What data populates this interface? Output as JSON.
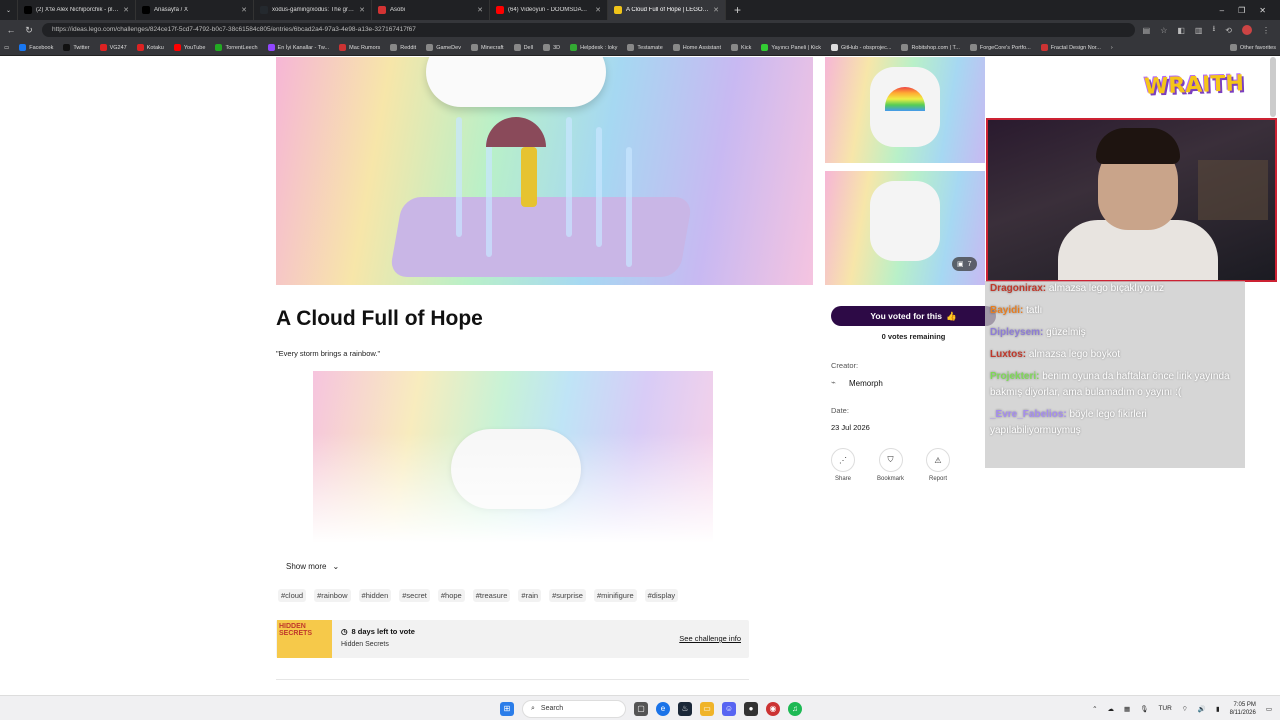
{
  "browser": {
    "tabs": [
      {
        "label": "(2) X'te Alex Nichiporchik - play S...",
        "icon": "x-icon",
        "color": "#000000"
      },
      {
        "label": "Anasayfa / X",
        "icon": "x-icon",
        "color": "#000000"
      },
      {
        "label": "xodus-gaming/xodus: The great g...",
        "icon": "github-icon",
        "color": "#24292e"
      },
      {
        "label": "Asobi",
        "icon": "asobi-icon",
        "color": "#d33333"
      },
      {
        "label": "(64) Videoyun - DOOMSDAY'den",
        "icon": "youtube-icon",
        "color": "#ff0000"
      },
      {
        "label": "A Cloud Full of Hope | LEGO® Ide...",
        "icon": "lego-icon",
        "color": "#f0c419",
        "active": true
      }
    ],
    "url": "https://ideas.lego.com/challenges/824ce17f-5cd7-4792-b0c7-38c61584c805/entries/6bcad2a4-97a3-4e98-a13e-327167417f67",
    "bookmarks": [
      {
        "label": "Facebook",
        "color": "#1877f2"
      },
      {
        "label": "Twitter",
        "color": "#111111"
      },
      {
        "label": "VG247",
        "color": "#d22"
      },
      {
        "label": "Kotaku",
        "color": "#d22"
      },
      {
        "label": "YouTube",
        "color": "#f00"
      },
      {
        "label": "TorrentLeech",
        "color": "#2a2"
      },
      {
        "label": "En İyi Kanallar - Tw...",
        "color": "#9146ff"
      },
      {
        "label": "Mac Rumors",
        "color": "#c33"
      },
      {
        "label": "Reddit",
        "color": "#888"
      },
      {
        "label": "GameDev",
        "color": "#888"
      },
      {
        "label": "Minecraft",
        "color": "#888"
      },
      {
        "label": "Dell",
        "color": "#888"
      },
      {
        "label": "3D",
        "color": "#888"
      },
      {
        "label": "Helpdesk : loky",
        "color": "#3a3"
      },
      {
        "label": "Testamate",
        "color": "#888"
      },
      {
        "label": "Home Assistant",
        "color": "#888"
      },
      {
        "label": "Kick",
        "color": "#888"
      },
      {
        "label": "Yayıncı Paneli | Kick",
        "color": "#3c3"
      },
      {
        "label": "GitHub - obsprojec...",
        "color": "#ddd"
      },
      {
        "label": "Robitshop.com | T...",
        "color": "#888"
      },
      {
        "label": "ForgeCore's Portfo...",
        "color": "#888"
      },
      {
        "label": "Fractal Design Nor...",
        "color": "#c33"
      }
    ],
    "other_favorites": "Other favorites"
  },
  "entry": {
    "title": "A Cloud Full of Hope",
    "quote": "\"Every storm brings a rainbow.\"",
    "image_count": "7",
    "show_more": "Show more",
    "tags": [
      "#cloud",
      "#rainbow",
      "#hidden",
      "#secret",
      "#hope",
      "#treasure",
      "#rain",
      "#surprise",
      "#minifigure",
      "#display"
    ],
    "challenge": {
      "logo_text": "HIDDEN SECRETS",
      "days_left": "8 days left to vote",
      "name": "Hidden Secrets",
      "info_link": "See challenge info"
    }
  },
  "sidebar": {
    "vote_button": "You voted for this",
    "votes_remaining": "0 votes remaining",
    "creator_label": "Creator:",
    "creator_name": "Memorph",
    "date_label": "Date:",
    "date_value": "23 Jul 2026",
    "actions": [
      {
        "label": "Share",
        "icon": "share-icon"
      },
      {
        "label": "Bookmark",
        "icon": "bookmark-icon"
      },
      {
        "label": "Report",
        "icon": "report-icon"
      }
    ]
  },
  "overlay": {
    "brand": "WRAITH",
    "chat": [
      {
        "user": "Dragonirax:",
        "color": "#c0392b",
        "text": "almazsa lego bıçaklıyoruz"
      },
      {
        "user": "Bayidi:",
        "color": "#e67e22",
        "text": "tatlı"
      },
      {
        "user": "Dipleysem:",
        "color": "#8e7dd6",
        "text": "güzelmiş"
      },
      {
        "user": "Luxtos:",
        "color": "#c0392b",
        "text": "almazsa lego boykot"
      },
      {
        "user": "Projekteri:",
        "color": "#7ed957",
        "text": "benim oyuna da haftalar önce lirik yayında bakmış diyorlar, ama bulamadım o yayını :("
      },
      {
        "user": "_Evre_Fabelios:",
        "color": "#a58cf0",
        "text": "böyle lego fikirleri yapılabiliyormuymuş"
      }
    ]
  },
  "taskbar": {
    "search_placeholder": "Search",
    "language": "TUR",
    "time": "7:05 PM",
    "date": "8/11/2026"
  }
}
